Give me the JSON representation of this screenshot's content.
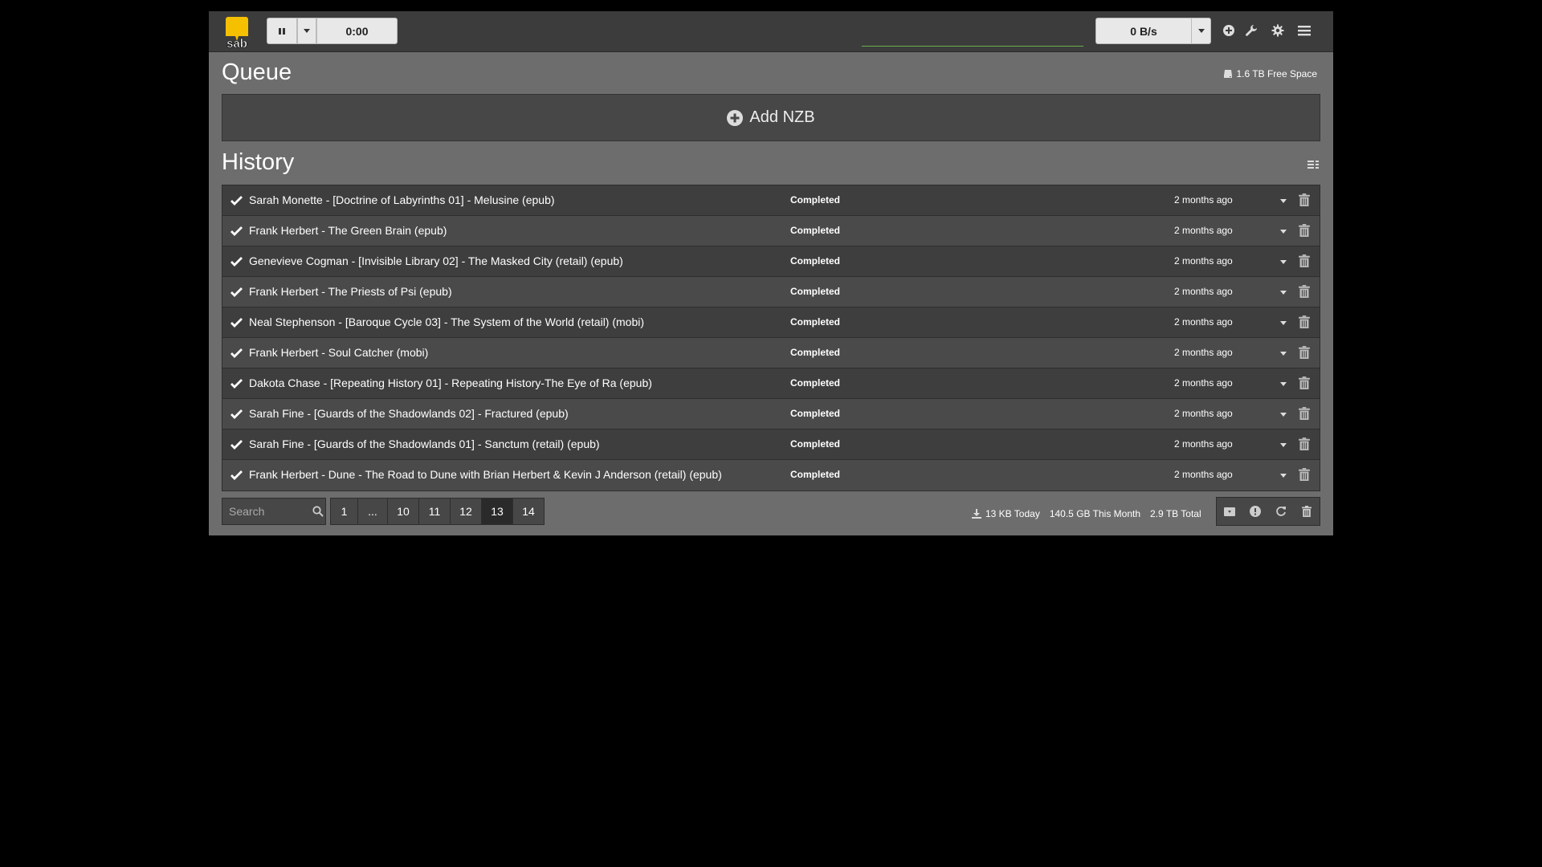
{
  "navbar": {
    "logo_text": "sab",
    "pause_icon": "pause-icon",
    "timer": "0:00",
    "speed": "0 B/s",
    "icons": [
      "add-circle-icon",
      "wrench-icon",
      "gear-icon",
      "menu-icon"
    ]
  },
  "queue": {
    "title": "Queue",
    "free_space": "1.6 TB Free Space",
    "add_nzb_label": "Add NZB"
  },
  "history": {
    "title": "History",
    "rows": [
      {
        "name": "Sarah Monette - [Doctrine of Labyrinths 01] - Melusine (epub)",
        "status": "Completed",
        "time": "2 months ago"
      },
      {
        "name": "Frank Herbert - The Green Brain (epub)",
        "status": "Completed",
        "time": "2 months ago"
      },
      {
        "name": "Genevieve Cogman - [Invisible Library 02] - The Masked City (retail) (epub)",
        "status": "Completed",
        "time": "2 months ago"
      },
      {
        "name": "Frank Herbert - The Priests of Psi (epub)",
        "status": "Completed",
        "time": "2 months ago"
      },
      {
        "name": "Neal Stephenson - [Baroque Cycle 03] - The System of the World (retail) (mobi)",
        "status": "Completed",
        "time": "2 months ago"
      },
      {
        "name": "Frank Herbert - Soul Catcher (mobi)",
        "status": "Completed",
        "time": "2 months ago"
      },
      {
        "name": "Dakota Chase - [Repeating History 01] - Repeating History-The Eye of Ra (epub)",
        "status": "Completed",
        "time": "2 months ago"
      },
      {
        "name": "Sarah Fine - [Guards of the Shadowlands 02] - Fractured (epub)",
        "status": "Completed",
        "time": "2 months ago"
      },
      {
        "name": "Sarah Fine - [Guards of the Shadowlands 01] - Sanctum (retail) (epub)",
        "status": "Completed",
        "time": "2 months ago"
      },
      {
        "name": "Frank Herbert - Dune - The Road to Dune with Brian Herbert & Kevin J Anderson (retail) (epub)",
        "status": "Completed",
        "time": "2 months ago"
      }
    ]
  },
  "footer": {
    "search_placeholder": "Search",
    "pages": [
      "1",
      "...",
      "10",
      "11",
      "12",
      "13",
      "14"
    ],
    "active_page": "13",
    "stats": {
      "today": "13 KB Today",
      "month": "140.5 GB This Month",
      "total": "2.9 TB Total"
    }
  },
  "colors": {
    "page_bg": "#000000",
    "app_bg": "#6d6d6d",
    "navbar_bg": "#3c3c3c",
    "row_odd": "#3e3e3e",
    "row_even": "#4a4a4a",
    "logo_yellow": "#f5c000",
    "speed_underline": "#6ab04c"
  }
}
